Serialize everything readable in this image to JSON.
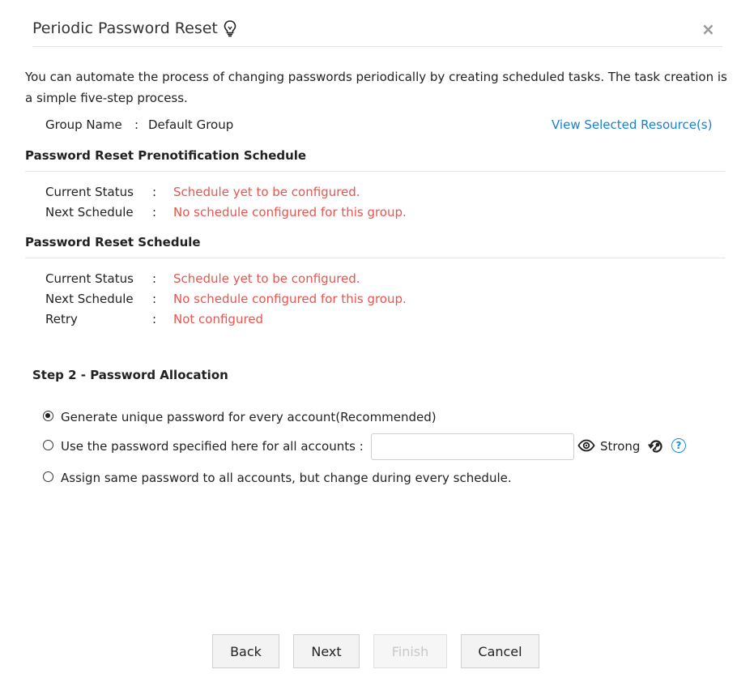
{
  "dialog": {
    "title": "Periodic Password Reset",
    "close_label": "×",
    "intro": "You can automate the process of changing passwords periodically by creating scheduled tasks. The task creation is a simple five-step process."
  },
  "group": {
    "label": "Group Name",
    "colon": ":",
    "value": "Default Group",
    "view_link": "View Selected Resource(s)"
  },
  "prenotification": {
    "heading": "Password Reset Prenotification Schedule",
    "current_status_label": "Current Status",
    "current_status_value": "Schedule yet to be configured.",
    "next_schedule_label": "Next Schedule",
    "next_schedule_value": "No schedule configured for this group."
  },
  "reset_schedule": {
    "heading": "Password Reset Schedule",
    "current_status_label": "Current Status",
    "current_status_value": "Schedule yet to be configured.",
    "next_schedule_label": "Next Schedule",
    "next_schedule_value": "No schedule configured for this group.",
    "retry_label": "Retry",
    "retry_value": "Not configured"
  },
  "step": {
    "heading": "Step 2 - Password Allocation",
    "options": [
      {
        "label": "Generate unique password for every account(Recommended)",
        "selected": true
      },
      {
        "label": "Use the password specified here for all accounts :",
        "selected": false
      },
      {
        "label": "Assign same password to all accounts, but change during every schedule.",
        "selected": false
      }
    ],
    "password_value": "",
    "strength_label": "Strong",
    "help_label": "?"
  },
  "buttons": {
    "back": "Back",
    "next": "Next",
    "finish": "Finish",
    "cancel": "Cancel"
  },
  "colors": {
    "error_text": "#e8554e",
    "link": "#1a7fd1",
    "help_icon": "#1a8fe0"
  },
  "icons": [
    "lightbulb-icon",
    "close-icon",
    "eye-icon",
    "password-generator-icon",
    "help-icon"
  ]
}
